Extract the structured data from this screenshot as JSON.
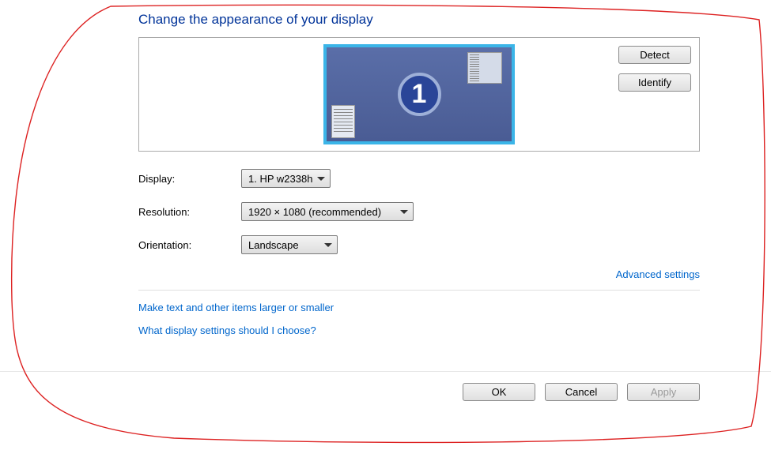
{
  "heading": "Change the appearance of your display",
  "monitor_number": "1",
  "buttons": {
    "detect": "Detect",
    "identify": "Identify",
    "ok": "OK",
    "cancel": "Cancel",
    "apply": "Apply"
  },
  "fields": {
    "display": {
      "label": "Display:",
      "value": "1. HP w2338h"
    },
    "resolution": {
      "label": "Resolution:",
      "value": "1920 × 1080 (recommended)"
    },
    "orientation": {
      "label": "Orientation:",
      "value": "Landscape"
    }
  },
  "links": {
    "advanced": "Advanced settings",
    "larger": "Make text and other items larger or smaller",
    "help": "What display settings should I choose?"
  }
}
